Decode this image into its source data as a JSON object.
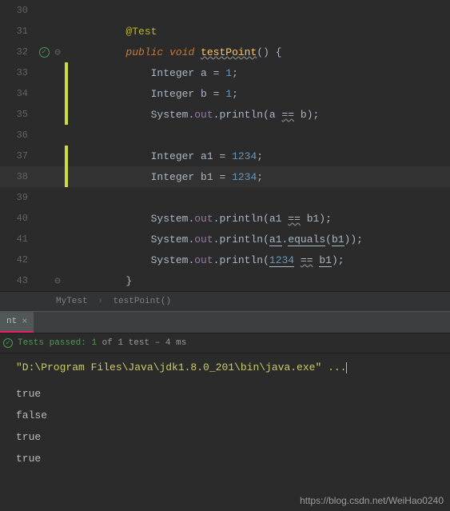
{
  "editor": {
    "lines": [
      {
        "n": 30,
        "bar": false,
        "icon": "",
        "fold": "",
        "indent": 8,
        "tokens": []
      },
      {
        "n": 31,
        "bar": false,
        "icon": "",
        "fold": "",
        "indent": 8,
        "tokens": [
          {
            "t": "@Test",
            "c": "ann"
          }
        ]
      },
      {
        "n": 32,
        "bar": false,
        "icon": "chk",
        "fold": "⊖",
        "indent": 8,
        "tokens": [
          {
            "t": "public",
            "c": "kw"
          },
          {
            "t": " "
          },
          {
            "t": "void",
            "c": "ret"
          },
          {
            "t": " "
          },
          {
            "t": "testPoint",
            "c": "fn underline"
          },
          {
            "t": "() {",
            "c": "op"
          }
        ]
      },
      {
        "n": 33,
        "bar": true,
        "icon": "",
        "fold": "",
        "indent": 12,
        "tokens": [
          {
            "t": "Integer ",
            "c": "type"
          },
          {
            "t": "a ",
            "c": "op"
          },
          {
            "t": "= ",
            "c": "op"
          },
          {
            "t": "1",
            "c": "num"
          },
          {
            "t": ";",
            "c": "op"
          }
        ]
      },
      {
        "n": 34,
        "bar": true,
        "icon": "",
        "fold": "",
        "indent": 12,
        "tokens": [
          {
            "t": "Integer ",
            "c": "type"
          },
          {
            "t": "b ",
            "c": "op"
          },
          {
            "t": "= ",
            "c": "op"
          },
          {
            "t": "1",
            "c": "num"
          },
          {
            "t": ";",
            "c": "op"
          }
        ]
      },
      {
        "n": 35,
        "bar": true,
        "icon": "",
        "fold": "",
        "indent": 12,
        "tokens": [
          {
            "t": "System",
            "c": "type"
          },
          {
            "t": ".",
            "c": "op"
          },
          {
            "t": "out",
            "c": "field"
          },
          {
            "t": ".",
            "c": "op"
          },
          {
            "t": "println",
            "c": "op"
          },
          {
            "t": "(a ",
            "c": "op"
          },
          {
            "t": "==",
            "c": "op underline"
          },
          {
            "t": " b);",
            "c": "op"
          }
        ]
      },
      {
        "n": 36,
        "bar": false,
        "icon": "",
        "fold": "",
        "indent": 12,
        "tokens": []
      },
      {
        "n": 37,
        "bar": true,
        "icon": "",
        "fold": "",
        "indent": 12,
        "tokens": [
          {
            "t": "Integer ",
            "c": "type"
          },
          {
            "t": "a1 ",
            "c": "op"
          },
          {
            "t": "= ",
            "c": "op"
          },
          {
            "t": "1234",
            "c": "num"
          },
          {
            "t": ";",
            "c": "op"
          }
        ]
      },
      {
        "n": 38,
        "bar": true,
        "icon": "",
        "fold": "",
        "indent": 12,
        "hl": true,
        "tokens": [
          {
            "t": "Integer ",
            "c": "type"
          },
          {
            "t": "b1 ",
            "c": "op"
          },
          {
            "t": "= ",
            "c": "op"
          },
          {
            "t": "1234",
            "c": "num"
          },
          {
            "t": ";",
            "c": "op"
          }
        ]
      },
      {
        "n": 39,
        "bar": false,
        "icon": "",
        "fold": "",
        "indent": 12,
        "tokens": []
      },
      {
        "n": 40,
        "bar": false,
        "icon": "",
        "fold": "",
        "indent": 12,
        "tokens": [
          {
            "t": "System",
            "c": "type"
          },
          {
            "t": ".",
            "c": "op"
          },
          {
            "t": "out",
            "c": "field"
          },
          {
            "t": ".",
            "c": "op"
          },
          {
            "t": "println",
            "c": "op"
          },
          {
            "t": "(a1 ",
            "c": "op"
          },
          {
            "t": "==",
            "c": "op underline"
          },
          {
            "t": " b1);",
            "c": "op"
          }
        ]
      },
      {
        "n": 41,
        "bar": false,
        "icon": "",
        "fold": "",
        "indent": 12,
        "tokens": [
          {
            "t": "System",
            "c": "type"
          },
          {
            "t": ".",
            "c": "op"
          },
          {
            "t": "out",
            "c": "field"
          },
          {
            "t": ".",
            "c": "op"
          },
          {
            "t": "println",
            "c": "op"
          },
          {
            "t": "(",
            "c": "op"
          },
          {
            "t": "a1",
            "c": "op underline-y"
          },
          {
            "t": ".",
            "c": "op"
          },
          {
            "t": "equals",
            "c": "op underline-y"
          },
          {
            "t": "(",
            "c": "op"
          },
          {
            "t": "b1",
            "c": "op underline-y"
          },
          {
            "t": ")",
            "c": "op"
          },
          {
            "t": ");",
            "c": "op"
          }
        ]
      },
      {
        "n": 42,
        "bar": false,
        "icon": "",
        "fold": "",
        "indent": 12,
        "tokens": [
          {
            "t": "System",
            "c": "type"
          },
          {
            "t": ".",
            "c": "op"
          },
          {
            "t": "out",
            "c": "field"
          },
          {
            "t": ".",
            "c": "op"
          },
          {
            "t": "println",
            "c": "op"
          },
          {
            "t": "(",
            "c": "op"
          },
          {
            "t": "1234",
            "c": "num underline-y"
          },
          {
            "t": " ",
            "c": "op"
          },
          {
            "t": "==",
            "c": "op underline"
          },
          {
            "t": " ",
            "c": "op"
          },
          {
            "t": "b1",
            "c": "op underline-y"
          },
          {
            "t": ");",
            "c": "op"
          }
        ]
      },
      {
        "n": 43,
        "bar": false,
        "icon": "",
        "fold": "⊖",
        "indent": 8,
        "tokens": [
          {
            "t": "}",
            "c": "op"
          }
        ]
      }
    ]
  },
  "breadcrumb": {
    "cls": "MyTest",
    "method": "testPoint()"
  },
  "tab": {
    "label": "nt",
    "close": "×"
  },
  "test": {
    "passed": "Tests passed:",
    "count": "1",
    "of": "of 1 test",
    "time": "– 4 ms"
  },
  "console": {
    "cmd": "\"D:\\Program Files\\Java\\jdk1.8.0_201\\bin\\java.exe\" ...",
    "output": [
      "true",
      "false",
      "true",
      "true"
    ]
  },
  "watermark": "https://blog.csdn.net/WeiHao0240"
}
